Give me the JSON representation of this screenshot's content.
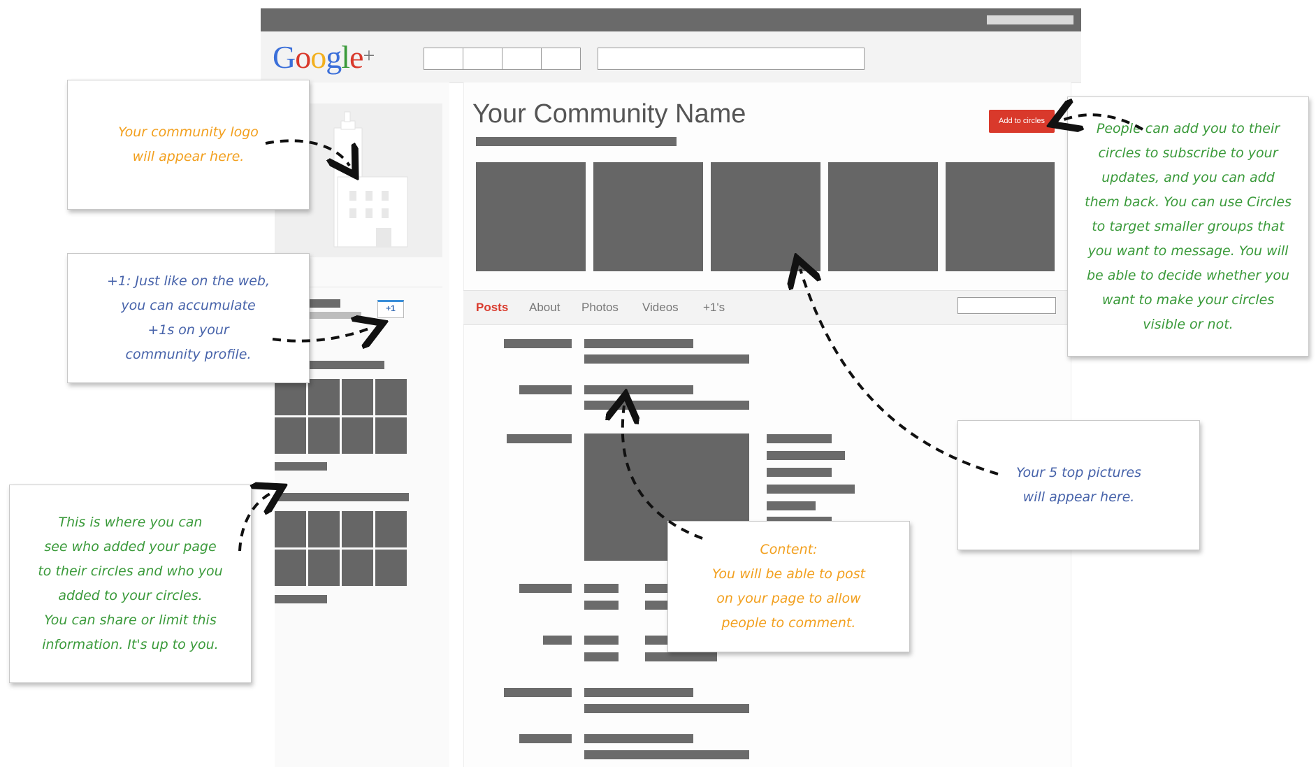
{
  "brand": {
    "logo_letters": [
      "G",
      "o",
      "o",
      "g",
      "l",
      "e",
      "+"
    ],
    "logo_colors": [
      "#3b6fd9",
      "#d9392b",
      "#f2b01f",
      "#3b6fd9",
      "#3a9a3a",
      "#d9392b",
      "#777777"
    ]
  },
  "profile": {
    "community_name": "Your Community Name",
    "add_button": "Add to circles",
    "plus_one_badge": "+1"
  },
  "tabs": [
    {
      "label": "Posts",
      "active": true
    },
    {
      "label": "About",
      "active": false
    },
    {
      "label": "Photos",
      "active": false
    },
    {
      "label": "Videos",
      "active": false
    },
    {
      "label": "+1's",
      "active": false
    }
  ],
  "annotations": {
    "logo": {
      "text": "Your community logo\nwill appear here.",
      "color": "#f2a01f"
    },
    "plus_ones": {
      "text": "+1: Just like on the web,\nyou can accumulate\n+1s on your\ncommunity profile.",
      "color": "#4763aa"
    },
    "circles_list": {
      "text": "This is where you can\nsee who added your page\nto their circles and who you\nadded to your circles.\nYou can share or limit this\ninformation. It's up to you.",
      "color": "#3a9a3a"
    },
    "add_circles": {
      "text": "People can add you to their\ncircles to subscribe to your\nupdates, and you can add\nthem back. You can use Circles\nto target smaller groups that\nyou want to message. You will\nbe able to decide whether you\nwant to make your circles\nvisible or not.",
      "color": "#3a9a3a"
    },
    "top_pictures": {
      "text": "Your 5 top pictures\nwill appear here.",
      "color": "#4763aa"
    },
    "content": {
      "text": "Content:\nYou will be able to post\non your page to allow\npeople to comment.",
      "color": "#f2a01f"
    }
  },
  "colors": {
    "accent_red": "#d9392b",
    "placeholder_gray": "#666666"
  }
}
